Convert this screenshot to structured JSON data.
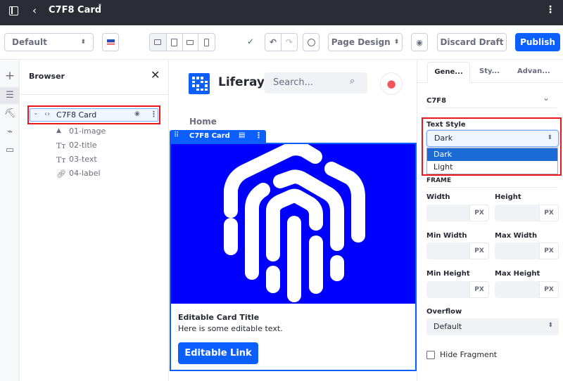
{
  "header": {
    "title": "C7F8 Card",
    "modified_mark": "*"
  },
  "toolbar": {
    "experience": "Default",
    "language_flag": "en-US",
    "viewports": [
      "desktop",
      "tablet",
      "landscape-phone",
      "portrait-phone"
    ],
    "page_design": "Page Design",
    "discard": "Discard Draft",
    "publish": "Publish",
    "accent": "#0b5fff"
  },
  "browser": {
    "title": "Browser",
    "root": "C7F8 Card",
    "children": [
      {
        "icon": "image-icon",
        "label": "01-image"
      },
      {
        "icon": "text-icon",
        "label": "02-title"
      },
      {
        "icon": "text-icon",
        "label": "03-text"
      },
      {
        "icon": "link-icon",
        "label": "04-label"
      }
    ]
  },
  "site": {
    "name": "Liferay",
    "search_placeholder": "Search...",
    "nav": "Home"
  },
  "fragment": {
    "label": "C7F8 Card",
    "image_bg": "#0000ff",
    "title": "Editable Card Title",
    "text": "Here is some editable text.",
    "link": "Editable Link"
  },
  "panel": {
    "tabs": [
      "Gene...",
      "Sty...",
      "Advan..."
    ],
    "section": "C7F8",
    "text_style_label": "Text Style",
    "text_style_value": "Dark",
    "options": [
      "Dark",
      "Light"
    ],
    "hidden_label": "FRAME",
    "fields": [
      {
        "label": "Width",
        "unit": "PX"
      },
      {
        "label": "Height",
        "unit": "PX"
      },
      {
        "label": "Min Width",
        "unit": "PX"
      },
      {
        "label": "Max Width",
        "unit": "PX"
      },
      {
        "label": "Min Height",
        "unit": "PX"
      },
      {
        "label": "Max Height",
        "unit": "PX"
      }
    ],
    "overflow_label": "Overflow",
    "overflow_value": "Default",
    "hide_fragment": "Hide Fragment"
  }
}
